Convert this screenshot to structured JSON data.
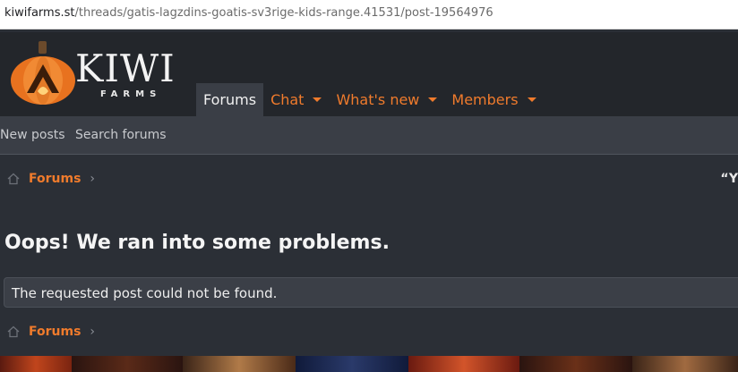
{
  "browser": {
    "url_host": "kiwifarms.st",
    "url_path": "/threads/gatis-lagzdins-goatis-sv3rige-kids-range.41531/post-19564976"
  },
  "header": {
    "logo_word": "KIWI",
    "logo_sub": "FARMS",
    "logo_icon": "pumpkin-icon",
    "nav": [
      {
        "label": "Forums",
        "active": true
      },
      {
        "label": "Chat",
        "dropdown": true
      },
      {
        "label": "What's new",
        "dropdown": true
      },
      {
        "label": "Members",
        "dropdown": true
      }
    ]
  },
  "subnav": {
    "new_posts": "New posts",
    "search_forums": "Search forums"
  },
  "breadcrumb": {
    "label": "Forums",
    "home_icon": "home-icon",
    "chevron_icon": "chevron-right-icon"
  },
  "quote_fragment": "“Y",
  "error": {
    "title": "Oops! We ran into some problems.",
    "message": "The requested post could not be found."
  },
  "colors": {
    "accent": "#f07b2c",
    "header_bg": "#23262b",
    "nav_bg": "#3a3e46",
    "page_bg": "#2b2f36"
  }
}
